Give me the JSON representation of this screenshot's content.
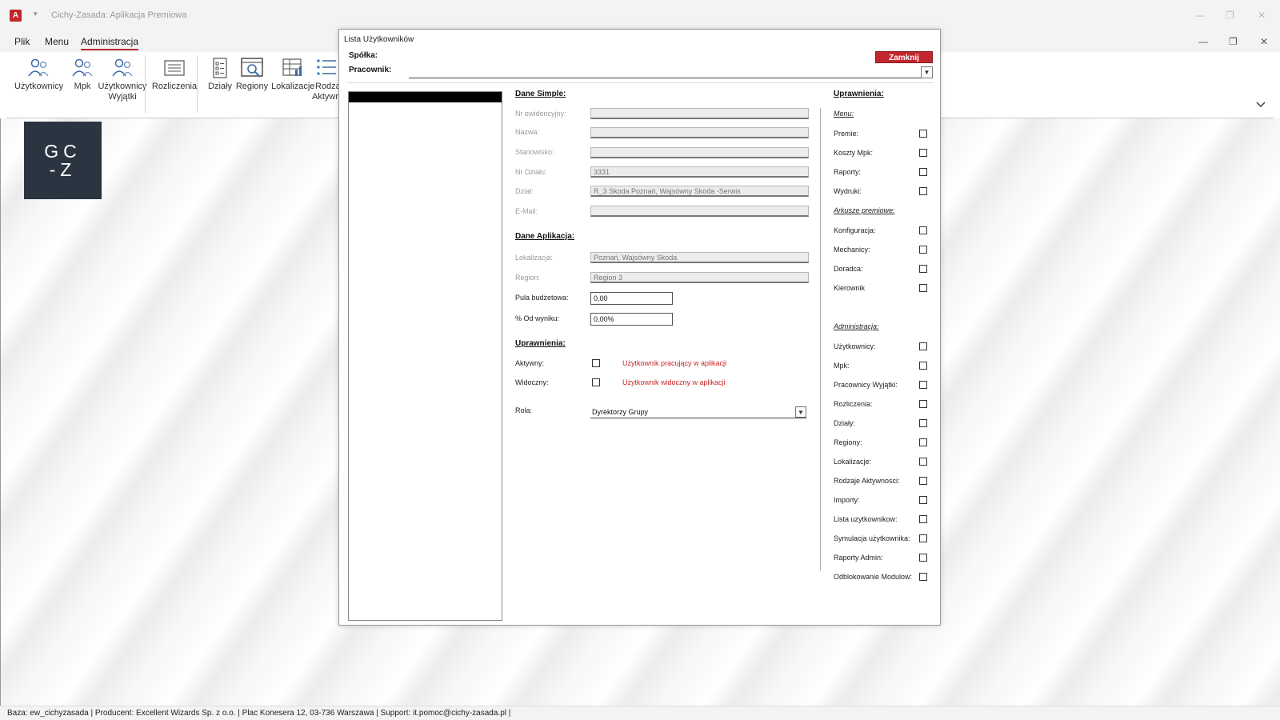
{
  "app": {
    "title": "Cichy-Zasada: Aplikacja Premiowa",
    "icon_label": "A",
    "qat_arrow": "▾",
    "window_controls": [
      "—",
      "❐",
      "✕"
    ],
    "mdi_controls": [
      "—",
      "❐",
      "✕"
    ]
  },
  "ribbon": {
    "tabs": [
      "Plik",
      "Menu",
      "Administracja"
    ],
    "active_tab": "Administracja",
    "buttons": [
      {
        "line1": "Użytkownicy",
        "line2": "",
        "icon": "users-icon"
      },
      {
        "line1": "Mpk",
        "line2": "",
        "icon": "users-icon"
      },
      {
        "line1": "Użytkownicy",
        "line2": "Wyjątki",
        "icon": "users-icon"
      },
      {
        "line1": "Rozliczenia",
        "line2": "",
        "icon": "list-form-icon"
      },
      {
        "line1": "Działy",
        "line2": "",
        "icon": "document-list-icon"
      },
      {
        "line1": "Regiony",
        "line2": "",
        "icon": "search-form-icon"
      },
      {
        "line1": "Lokalizacje",
        "line2": "",
        "icon": "table-chart-icon"
      },
      {
        "line1": "Rodza",
        "line2": "Aktywno",
        "icon": "bullet-list-icon"
      }
    ],
    "collapse_icon": "chevron-down-icon"
  },
  "logo": {
    "line1": "GC",
    "line2": "-Z"
  },
  "status_bar": "Baza: ew_cichyzasada | Producent: Excellent Wizards Sp. z o.o. | Plac Konesera 12, 03-736 Warszawa | Support: it.pomoc@cichy-zasada.pl |",
  "dialog": {
    "title": "Lista Użytkowników",
    "spolka_label": "Spółka:",
    "pracownik_label": "Pracownik:",
    "close_label": "Zamknij",
    "dane_simple": {
      "header": "Dane Simple:",
      "fields": [
        {
          "label": "Nr ewidencyjny:",
          "value": ""
        },
        {
          "label": "Nazwa:",
          "value": ""
        },
        {
          "label": "Stanowisko:",
          "value": ""
        },
        {
          "label": "Nr Działu:",
          "value": "3331"
        },
        {
          "label": "Dział:",
          "value": "R_3 Skoda Poznań, Wajsówny Skoda -Serwis"
        },
        {
          "label": "E-Mail:",
          "value": ""
        }
      ]
    },
    "dane_aplikacja": {
      "header": "Dane Aplikacja:",
      "lokalizacja_label": "Lokalizacja:",
      "lokalizacja_value": "Poznań, Wajsówny Skoda",
      "region_label": "Region:",
      "region_value": "Region 3",
      "pula_label": "Pula budżetowa:",
      "pula_value": "0,00",
      "od_wyniku_label": "% Od wyniku:",
      "od_wyniku_value": "0,00%"
    },
    "uprawnienia_left": {
      "header": "Uprawnienia:",
      "aktywny_label": "Aktywny:",
      "aktywny_note": "Użytkownik pracujący w aplikacji",
      "widoczny_label": "Widoczny:",
      "widoczny_note": "Użytkownik widoczny w aplikacji",
      "rola_label": "Rola:",
      "rola_value": "Dyrektorzy Grupy"
    },
    "uprawnienia_right": {
      "header": "Uprawnienia:",
      "menu_header": "Menu:",
      "menu_items": [
        "Premie:",
        "Koszty Mpk:",
        "Raporty:",
        "Wydruki:"
      ],
      "arkusze_header": "Arkusze premiowe:",
      "arkusze_items": [
        "Konfiguracja:",
        "Mechanicy:",
        "Doradca:",
        "Kierownik"
      ],
      "admin_header": "Administracja:",
      "admin_items": [
        "Użytkownicy:",
        "Mpk:",
        "Pracownicy Wyjątki:",
        "Rozliczenia:",
        "Działy:",
        "Regiony:",
        "Lokalizacje:",
        "Rodzaje Aktywnosci:",
        "Importy:",
        "Lista uzytkownikow:",
        "Symulacja użytkownika:",
        "Raporty Admin:",
        "Odblokowanie Modulow:"
      ]
    }
  },
  "colors": {
    "accent_red": "#c1272d",
    "logo_bg": "#2b3542",
    "tab_underline": "#b3282d"
  }
}
